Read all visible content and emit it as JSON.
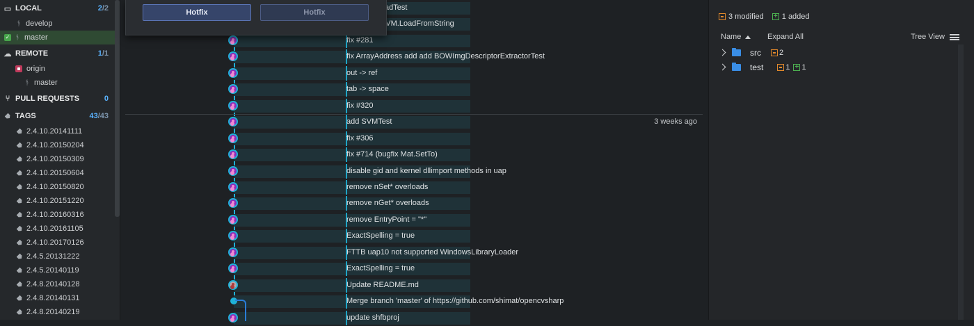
{
  "sidebar": {
    "local": {
      "label": "LOCAL",
      "count_hi": "2",
      "count_lo": "/2",
      "branches": [
        "develop",
        "master"
      ]
    },
    "remote": {
      "label": "REMOTE",
      "count_hi": "1",
      "count_lo": "/1",
      "origin": "origin",
      "branches": [
        "master"
      ]
    },
    "pull_requests": {
      "label": "PULL REQUESTS",
      "count": "0"
    },
    "tags": {
      "label": "TAGS",
      "count_hi": "43",
      "count_lo": "/43",
      "items": [
        "2.4.10.20141111",
        "2.4.10.20150204",
        "2.4.10.20150309",
        "2.4.10.20150604",
        "2.4.10.20150820",
        "2.4.10.20151220",
        "2.4.10.20160316",
        "2.4.10.20161105",
        "2.4.10.20170126",
        "2.4.5.20131222",
        "2.4.5.20140119",
        "2.4.8.20140128",
        "2.4.8.20140131",
        "2.4.8.20140219"
      ]
    }
  },
  "popup": {
    "button_primary": "Hotfix",
    "button_secondary": "Hotfix"
  },
  "commits": [
    {
      "msg": "est.SaveLoadTest",
      "date": ""
    },
    {
      "msg": "Load and SVM.LoadFromString",
      "date": ""
    },
    {
      "msg": "fix #281",
      "date": ""
    },
    {
      "msg": "fix ArrayAddress add add BOWImgDescriptorExtractorTest",
      "date": ""
    },
    {
      "msg": "out -> ref",
      "date": ""
    },
    {
      "msg": "tab -> space",
      "date": ""
    },
    {
      "msg": "fix #320",
      "date": ""
    },
    {
      "msg": "add SVMTest",
      "date": "3 weeks ago"
    },
    {
      "msg": "fix #306",
      "date": ""
    },
    {
      "msg": "fix #714 (bugfix Mat.SetTo)",
      "date": ""
    },
    {
      "msg": "disable gid and kernel dllimport methods in uap",
      "date": ""
    },
    {
      "msg": "remove nSet* overloads",
      "date": ""
    },
    {
      "msg": "remove nGet* overloads",
      "date": ""
    },
    {
      "msg": "remove EntryPoint = \"*\"",
      "date": ""
    },
    {
      "msg": "ExactSpelling = true",
      "date": ""
    },
    {
      "msg": "FTTB uap10 not supported WindowsLibraryLoader",
      "date": ""
    },
    {
      "msg": "ExactSpelling = true",
      "date": ""
    },
    {
      "msg": "Update README.md",
      "date": ""
    },
    {
      "msg": "Merge branch 'master' of https://github.com/shimat/opencvsharp",
      "date": ""
    },
    {
      "msg": "update shfbproj",
      "date": ""
    }
  ],
  "right_panel": {
    "modified_label": "3 modified",
    "added_label": "1 added",
    "sort_label": "Name",
    "expand_label": "Expand All",
    "view_label": "Tree View",
    "folders": [
      {
        "name": "src",
        "modified": "2",
        "added": ""
      },
      {
        "name": "test",
        "modified": "1",
        "added": "1"
      }
    ]
  },
  "colors": {
    "accent": "#1fb2d8",
    "node": "#8c2cb8",
    "modified": "#e2892b",
    "added": "#4caf50",
    "folder": "#3a8ee6"
  }
}
